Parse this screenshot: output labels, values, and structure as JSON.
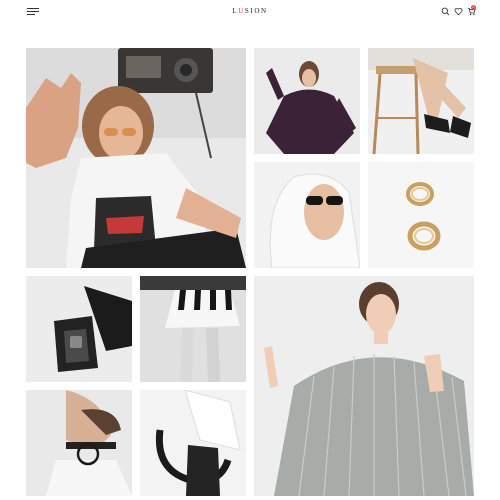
{
  "header": {
    "logo": {
      "pre": "L",
      "accent": "U",
      "post": "SION"
    },
    "cart_count": "0",
    "icons": [
      "menu-icon",
      "search-icon",
      "heart-icon",
      "cart-icon"
    ]
  },
  "colors": {
    "accent": "#e0473f",
    "text": "#222222",
    "background": "#ffffff"
  },
  "gallery": [
    "fashion-photo-model-with-radio",
    "fashion-photo-black-top",
    "fashion-photo-black-heels",
    "fashion-photo-sunglasses-hood",
    "fashion-photo-gold-earrings",
    "fashion-photo-black-bag",
    "fashion-photo-piano-skirt",
    "fashion-photo-pleated-dress",
    "fashion-photo-ring-necklace",
    "fashion-photo-bag-strap"
  ]
}
